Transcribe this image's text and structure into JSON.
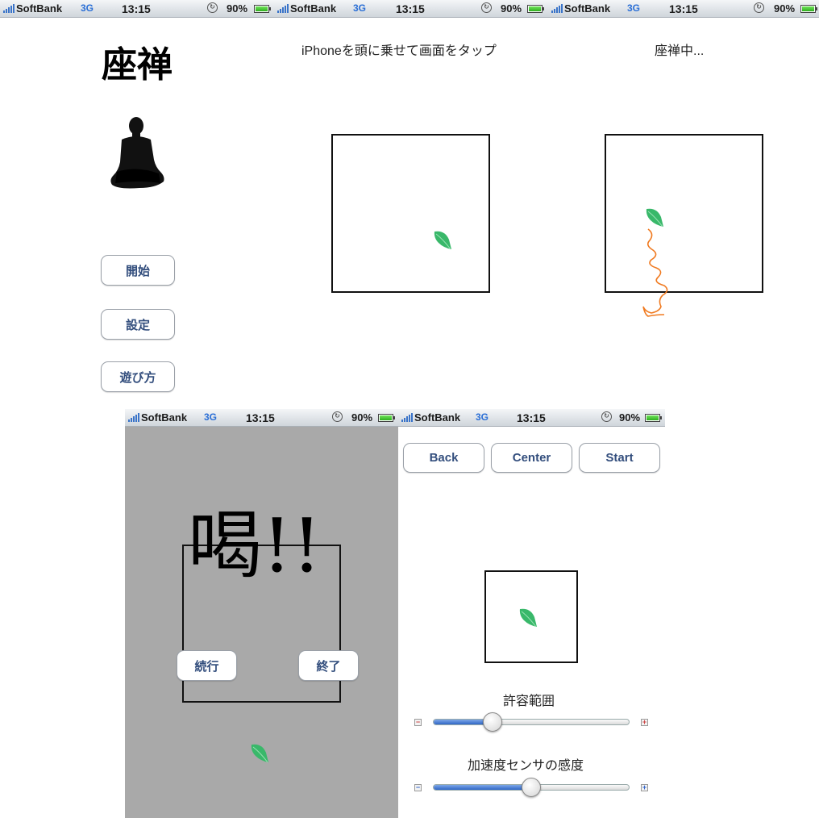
{
  "status_bar": {
    "carrier": "SoftBank",
    "network": "3G",
    "time": "13:15",
    "battery": "90%"
  },
  "screen_menu": {
    "title": "座禅",
    "buttons": {
      "start": "開始",
      "settings": "設定",
      "howto": "遊び方"
    }
  },
  "screen_tap": {
    "instruction": "iPhoneを頭に乗せて画面をタップ"
  },
  "screen_zazen": {
    "status": "座禅中..."
  },
  "screen_katsu": {
    "shout": "喝!!",
    "buttons": {
      "continue": "続行",
      "quit": "終了"
    }
  },
  "screen_settings": {
    "buttons": {
      "back": "Back",
      "center": "Center",
      "start": "Start"
    },
    "tolerance_label": "許容範囲",
    "sensitivity_label": "加速度センサの感度",
    "tolerance_value": 0.28,
    "sensitivity_value": 0.5,
    "minus_icon": "−",
    "plus_icon": "+"
  },
  "colors": {
    "leaf": "#39b86a",
    "trail": "#f07a20",
    "button_text": "#334e7d",
    "katsu_bg": "#a9a9a9"
  }
}
